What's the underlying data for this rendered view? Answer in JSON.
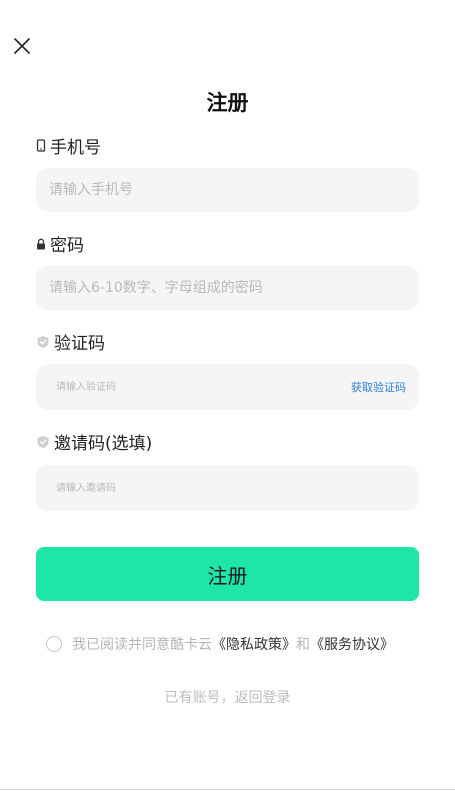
{
  "page": {
    "title": "注册"
  },
  "icons": {
    "close": "close-icon",
    "phone": "phone-icon",
    "lock": "lock-icon",
    "shield": "shield-icon",
    "radio": "radio-unchecked-icon"
  },
  "fields": {
    "phone": {
      "label": "手机号",
      "placeholder": "请输入手机号",
      "value": ""
    },
    "password": {
      "label": "密码",
      "placeholder": "请输入6-10数字、字母组成的密码",
      "value": ""
    },
    "code": {
      "label": "验证码",
      "placeholder": "请输入验证码",
      "value": "",
      "action": "获取验证码"
    },
    "invite": {
      "label": "邀请码(选填)",
      "placeholder": "请输入邀请码",
      "value": ""
    }
  },
  "submit": {
    "label": "注册"
  },
  "agreement": {
    "prefix": "我已阅读并同意酷卡云",
    "privacy": "《隐私政策》",
    "and": "和",
    "service": "《服务协议》",
    "checked": false
  },
  "login_link": "已有账号，返回登录",
  "colors": {
    "accent": "#1de6a6",
    "link": "#2f7fd8",
    "field_bg": "#f5f5f5",
    "muted": "#b5b5b5"
  }
}
